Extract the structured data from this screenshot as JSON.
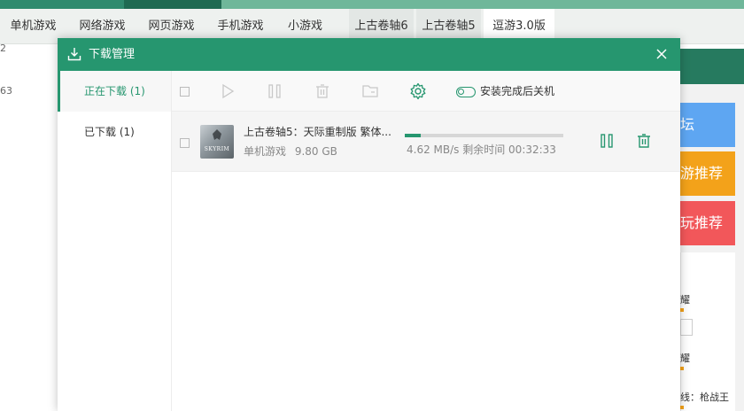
{
  "background": {
    "nav_tabs": [
      "单机游戏",
      "网络游戏",
      "网页游戏",
      "手机游戏",
      "小游戏",
      "上古卷轴6",
      "上古卷轴5",
      "逗游3.0版"
    ],
    "side_numbers": [
      "2",
      "63"
    ],
    "right_buttons": [
      "坛",
      "游推荐",
      "玩推荐"
    ],
    "right_texts": [
      "耀",
      "耀",
      "线：枪战王"
    ]
  },
  "dialog": {
    "title": "下载管理",
    "sidebar": [
      {
        "label": "正在下载 (1)",
        "active": true
      },
      {
        "label": "已下载 (1)",
        "active": false
      }
    ],
    "toolbar": {
      "shutdown_label": "安装完成后关机",
      "buttons": [
        "select-all",
        "start",
        "pause",
        "delete",
        "open-folder",
        "settings"
      ]
    },
    "downloads": [
      {
        "name": "上古卷轴5：天际重制版  繁体...",
        "category": "单机游戏",
        "size": "9.80 GB",
        "speed_line": "4.62 MB/s  剩余时间 00:32:33",
        "progress": 0.1,
        "cover_text": "SKYRIM"
      }
    ]
  },
  "colors": {
    "accent": "#26966f",
    "blue": "#5ea6f2",
    "orange": "#f3a21a",
    "red": "#f2575a"
  }
}
